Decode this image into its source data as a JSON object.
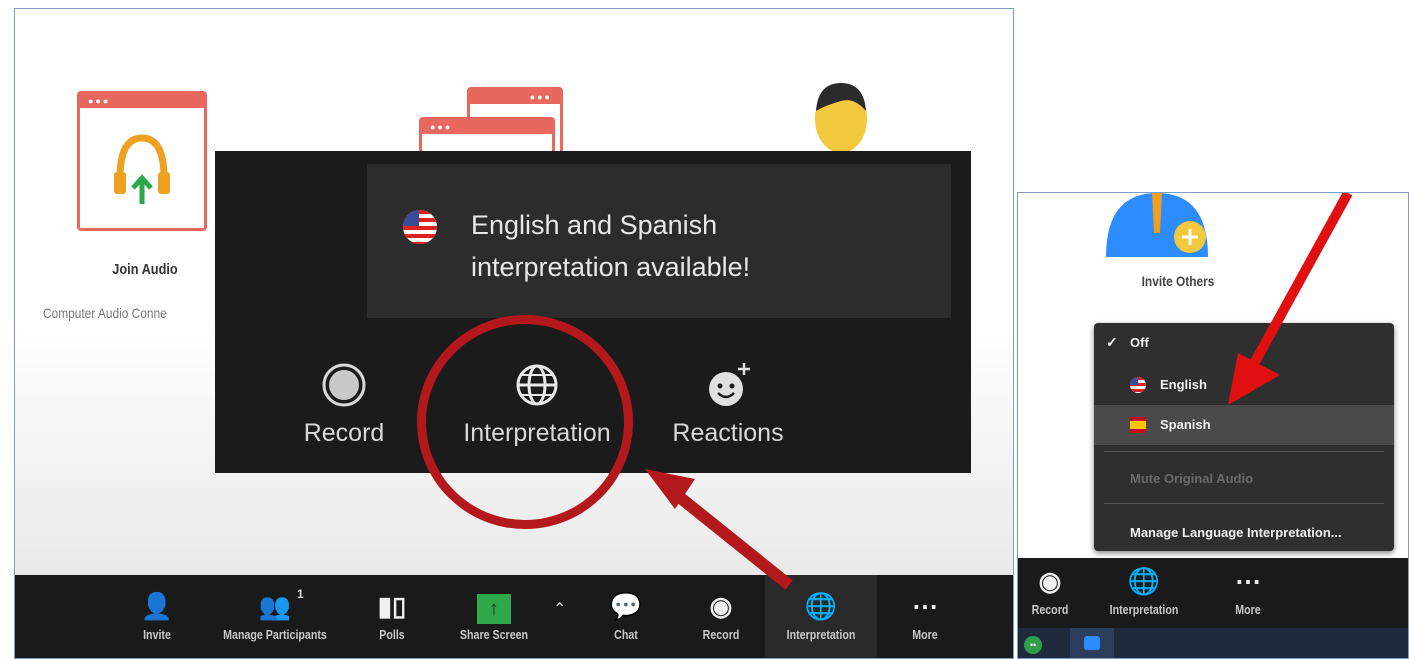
{
  "left": {
    "join_audio": {
      "label": "Join Audio",
      "sublabel": "Computer Audio Conne"
    },
    "tooltip": {
      "line1": "English and Spanish",
      "line2": "interpretation available!",
      "flag_icon": "us-flag-icon"
    },
    "popup_buttons": [
      {
        "label": "Record",
        "icon": "record-icon"
      },
      {
        "label": "Interpretation",
        "icon": "globe-icon"
      },
      {
        "label": "Reactions",
        "icon": "smile-plus-icon"
      }
    ],
    "toolbar": {
      "invite": "Invite",
      "manage_participants": "Manage Participants",
      "participants_count": "1",
      "polls": "Polls",
      "share_screen": "Share Screen",
      "chat": "Chat",
      "record": "Record",
      "interpretation": "Interpretation",
      "more": "More"
    },
    "highlight_color": "#b3181c"
  },
  "right": {
    "invite_others": "Invite Others",
    "menu": {
      "off": "Off",
      "english": "English",
      "spanish": "Spanish",
      "mute_original": "Mute Original Audio",
      "manage": "Manage Language Interpretation..."
    },
    "toolbar": {
      "record": "Record",
      "interpretation": "Interpretation",
      "more": "More"
    },
    "taskbar_green_label": "••"
  }
}
